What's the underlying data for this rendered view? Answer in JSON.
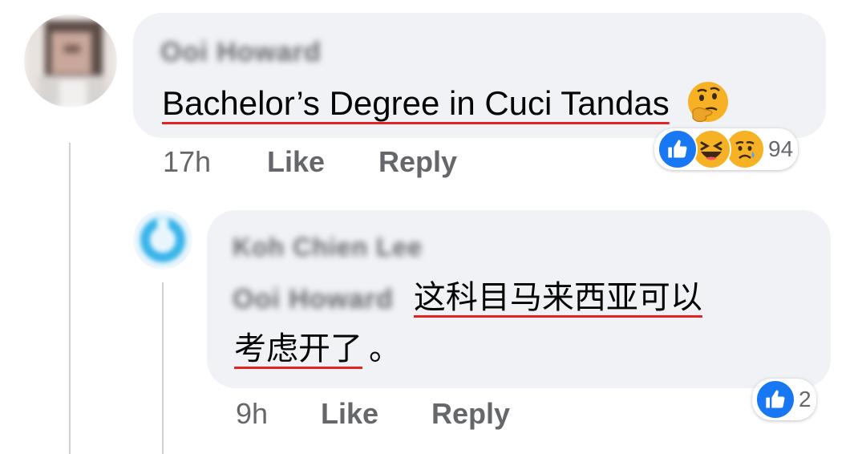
{
  "comments": [
    {
      "author": "Ooi Howard",
      "text": "Bachelor’s Degree in Cuci Tandas",
      "emoji": "🤔",
      "time": "17h",
      "like_label": "Like",
      "reply_label": "Reply",
      "reactions": {
        "icons": [
          "like-icon",
          "haha-icon",
          "sad-icon"
        ],
        "count": "94"
      }
    },
    {
      "author": "Koh Chien Lee",
      "mention": "Ooi Howard",
      "text_line1": "这科目马来西亚可以",
      "text_line2_underlined": "考虑开了",
      "text_line2_rest": "。",
      "time": "9h",
      "like_label": "Like",
      "reply_label": "Reply",
      "reactions": {
        "icons": [
          "like-icon"
        ],
        "count": "2"
      }
    }
  ],
  "colors": {
    "bubble": "#f0f2f5",
    "meta_text": "#65676b",
    "like_blue": "#1877f2",
    "haha_yellow": "#f7b125",
    "annotation_red": "#e02424"
  }
}
